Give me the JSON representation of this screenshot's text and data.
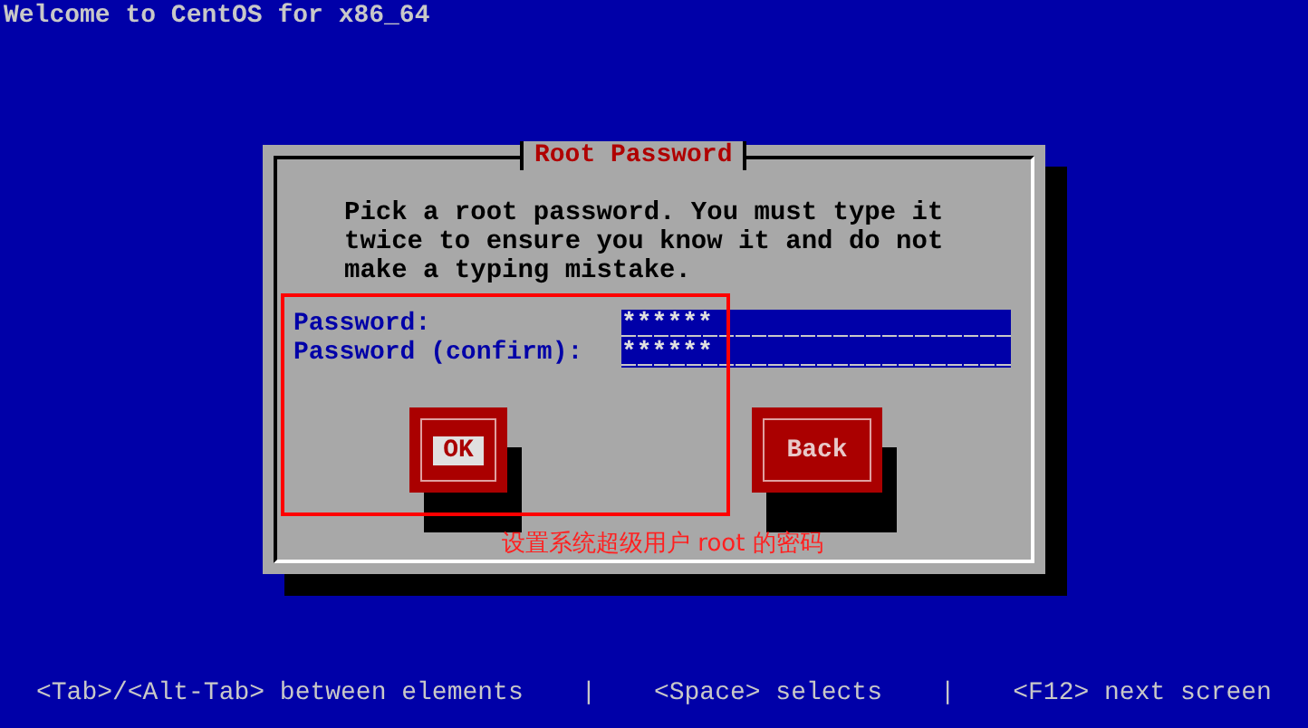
{
  "top_bar": {
    "title": "Welcome to CentOS for x86_64"
  },
  "dialog": {
    "title": "Root Password",
    "message": "Pick a root password. You must type it\ntwice to ensure you know it and do not\nmake a typing mistake.",
    "fields": [
      {
        "label": "Password:",
        "value": "******"
      },
      {
        "label": "Password (confirm):",
        "value": "******"
      }
    ],
    "buttons": [
      {
        "label": "OK",
        "selected": true
      },
      {
        "label": "Back",
        "selected": false
      }
    ]
  },
  "annotation": {
    "caption": "设置系统超级用户 root 的密码"
  },
  "status_bar": [
    "<Tab>/<Alt-Tab> between elements",
    "|",
    "<Space> selects",
    "|",
    "<F12> next screen"
  ]
}
